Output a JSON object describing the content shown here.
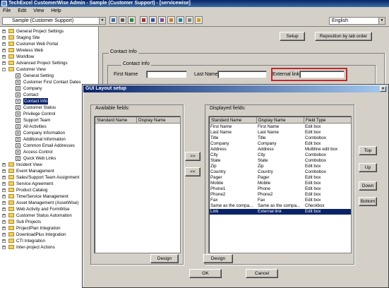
{
  "app": {
    "title": "TechExcel CustomerWise Admin - Sample (Customer Support) - [servicewise]",
    "menu": [
      "File",
      "Edit",
      "View",
      "Help"
    ]
  },
  "toolbar": {
    "project_combo": "Sample (Customer Support)",
    "language_combo": "English"
  },
  "tree": {
    "items": [
      {
        "label": "General Project Settings",
        "level": 0,
        "kind": "folder",
        "expander": "+"
      },
      {
        "label": "Staging Site",
        "level": 0,
        "kind": "folder",
        "expander": "+"
      },
      {
        "label": "Customer Web Portal",
        "level": 0,
        "kind": "folder",
        "expander": "+"
      },
      {
        "label": "Wireless Web",
        "level": 0,
        "kind": "folder",
        "expander": "+"
      },
      {
        "label": "Workflow",
        "level": 0,
        "kind": "folder",
        "expander": "+"
      },
      {
        "label": "Advanced Project Settings",
        "level": 0,
        "kind": "folder",
        "expander": "+"
      },
      {
        "label": "Customer View",
        "level": 0,
        "kind": "folder",
        "expander": "-"
      },
      {
        "label": "General Setting",
        "level": 1,
        "kind": "doc"
      },
      {
        "label": "Customer First Contact Dates",
        "level": 1,
        "kind": "doc"
      },
      {
        "label": "Company",
        "level": 1,
        "kind": "doc"
      },
      {
        "label": "Contact",
        "level": 1,
        "kind": "doc"
      },
      {
        "label": "Contact Info",
        "level": 1,
        "kind": "doc",
        "selected": true
      },
      {
        "label": "Customer Status",
        "level": 1,
        "kind": "doc"
      },
      {
        "label": "Privilege Control",
        "level": 1,
        "kind": "doc"
      },
      {
        "label": "Support Team",
        "level": 1,
        "kind": "doc"
      },
      {
        "label": "All Activities",
        "level": 1,
        "kind": "doc"
      },
      {
        "label": "Company Information",
        "level": 1,
        "kind": "doc"
      },
      {
        "label": "Additional Information",
        "level": 1,
        "kind": "doc"
      },
      {
        "label": "Common Email Addresses",
        "level": 1,
        "kind": "doc"
      },
      {
        "label": "Access Control",
        "level": 1,
        "kind": "doc"
      },
      {
        "label": "Quick Web Links",
        "level": 1,
        "kind": "doc"
      },
      {
        "label": "Incident View",
        "level": 0,
        "kind": "folder",
        "expander": "+"
      },
      {
        "label": "Event Management",
        "level": 0,
        "kind": "folder",
        "expander": "+"
      },
      {
        "label": "Sales/Support Team Assignment",
        "level": 0,
        "kind": "folder",
        "expander": "+"
      },
      {
        "label": "Service Agreement",
        "level": 0,
        "kind": "folder",
        "expander": "+"
      },
      {
        "label": "Product Catalog",
        "level": 0,
        "kind": "folder",
        "expander": "+"
      },
      {
        "label": "Time/Service Management",
        "level": 0,
        "kind": "folder",
        "expander": "+"
      },
      {
        "label": "Asset Management (AssetWise)",
        "level": 0,
        "kind": "folder",
        "expander": "+"
      },
      {
        "label": "Web Activity and FormWise",
        "level": 0,
        "kind": "folder",
        "expander": "+"
      },
      {
        "label": "Customer Status Automation",
        "level": 0,
        "kind": "folder",
        "expander": "+"
      },
      {
        "label": "Sub Projects",
        "level": 0,
        "kind": "folder",
        "expander": "+"
      },
      {
        "label": "ProjectPlan Integration",
        "level": 0,
        "kind": "folder",
        "expander": "+"
      },
      {
        "label": "DownloadPlus Integration",
        "level": 0,
        "kind": "folder",
        "expander": "+"
      },
      {
        "label": "CTI Integration",
        "level": 0,
        "kind": "folder",
        "expander": "+"
      },
      {
        "label": "Inter-project Actions",
        "level": 0,
        "kind": "folder",
        "expander": "+"
      }
    ]
  },
  "main": {
    "setup_btn": "Setup",
    "reposition_btn": "Reposition by tab order",
    "outer_group": "Contact Info",
    "inner_group": "Contact Info",
    "first_name_label": "First Name",
    "last_name_label": "Last Name",
    "external_link_label": "External link",
    "highlight_color": "#c0282a"
  },
  "dialog": {
    "title": "GUI Layout setup",
    "available_label": "Available fields:",
    "available_columns": [
      "Standard Name",
      "Display Name"
    ],
    "displayed_label": "Displayed fields:",
    "displayed_columns": [
      "Standard Name",
      "Display Name",
      "Field Type"
    ],
    "displayed_rows": [
      [
        "First Name",
        "First Name",
        "Edit box"
      ],
      [
        "Last Name",
        "Last Name",
        "Edit box"
      ],
      [
        "Title",
        "Title",
        "Combobox"
      ],
      [
        "Company",
        "Company",
        "Edit box"
      ],
      [
        "Address",
        "Address",
        "Multiline edit box"
      ],
      [
        "City",
        "City",
        "Combobox"
      ],
      [
        "State",
        "State",
        "Combobox"
      ],
      [
        "Zip",
        "Zip",
        "Edit box"
      ],
      [
        "Country",
        "Country",
        "Combobox"
      ],
      [
        "Pager",
        "Pager",
        "Edit box"
      ],
      [
        "Mobile",
        "Mobile",
        "Edit box"
      ],
      [
        "Phone1",
        "Phone",
        "Edit box"
      ],
      [
        "Phone2",
        "Phone2",
        "Edit box"
      ],
      [
        "Fax",
        "Fax",
        "Edit box"
      ],
      [
        "Same as the compa...",
        "Same as the compa...",
        "Checkbox"
      ],
      [
        "Link",
        "External link",
        "Edit box"
      ]
    ],
    "selected_row": 15,
    "add_btn": ">>",
    "remove_btn": "<<",
    "top_btn": "Top",
    "up_btn": "Up",
    "down_btn": "Down",
    "bottom_btn": "Bottom",
    "design_left_btn": "Design",
    "design_right_btn": "Design",
    "ok_btn": "OK",
    "cancel_btn": "Cancel"
  }
}
